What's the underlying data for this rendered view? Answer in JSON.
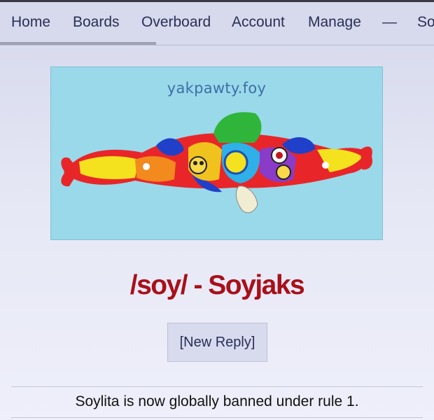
{
  "nav": {
    "items": [
      {
        "label": "Home"
      },
      {
        "label": "Boards"
      },
      {
        "label": "Overboard"
      },
      {
        "label": "Account"
      },
      {
        "label": "Manage"
      },
      {
        "label": "—"
      },
      {
        "label": "So"
      }
    ],
    "load_progress": 0.36
  },
  "banner": {
    "text": "yakpawty.foy"
  },
  "board": {
    "title": "/soy/ - Soyjaks"
  },
  "actions": {
    "new_reply_label": "[New Reply]"
  },
  "announcement": {
    "text": "Soylita is now globally banned under rule 1."
  },
  "colors": {
    "title": "#a8101a",
    "nav_text": "#2a2f55",
    "banner_bg": "#9ad9e9"
  }
}
